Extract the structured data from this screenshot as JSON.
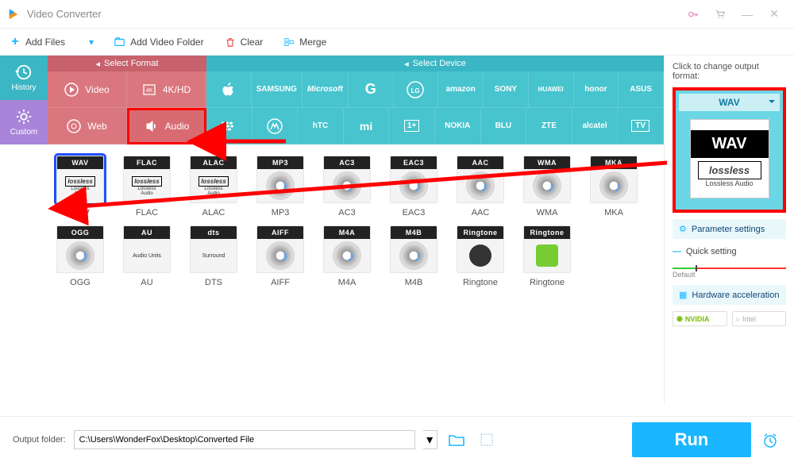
{
  "title": "Video Converter",
  "toolbar": {
    "add_files": "Add Files",
    "add_folder": "Add Video Folder",
    "clear": "Clear",
    "merge": "Merge"
  },
  "rail": {
    "history": "History",
    "custom": "Custom"
  },
  "cat_headers": {
    "format": "Select Format",
    "device": "Select Device"
  },
  "format_cats": {
    "video": "Video",
    "4k": "4K/HD",
    "web": "Web",
    "audio": "Audio"
  },
  "device_brands_row1": [
    "",
    "SAMSUNG",
    "Microsoft",
    "G",
    "LG",
    "amazon",
    "SONY",
    "HUAWEI",
    "honor",
    "ASUS"
  ],
  "device_brands_row2": [
    "",
    "",
    "hTC",
    "mi",
    "1+",
    "NOKIA",
    "BLU",
    "ZTE",
    "alcatel",
    "TV"
  ],
  "formats_row1": [
    {
      "head": "WAV",
      "body": "Lossless Audio",
      "label": "WAV",
      "selected": true,
      "lossless": true
    },
    {
      "head": "FLAC",
      "body": "Lossless Audio",
      "label": "FLAC",
      "lossless": true
    },
    {
      "head": "ALAC",
      "body": "Lossless Audio",
      "label": "ALAC",
      "lossless": true
    },
    {
      "head": "MP3",
      "body": "",
      "label": "MP3",
      "disc": true
    },
    {
      "head": "AC3",
      "body": "",
      "label": "AC3",
      "disc": true
    },
    {
      "head": "EAC3",
      "body": "",
      "label": "EAC3",
      "disc": true
    },
    {
      "head": "AAC",
      "body": "",
      "label": "AAC",
      "disc": true
    },
    {
      "head": "WMA",
      "body": "",
      "label": "WMA",
      "disc": true
    },
    {
      "head": "MKA",
      "body": "",
      "label": "MKA",
      "disc": true
    },
    {
      "head": "OGG",
      "body": "",
      "label": "OGG",
      "disc": true
    }
  ],
  "formats_row2": [
    {
      "head": "AU",
      "body": "Audio Units",
      "label": "AU"
    },
    {
      "head": "dts",
      "body": "Surround",
      "label": "DTS"
    },
    {
      "head": "AIFF",
      "body": "",
      "label": "AIFF",
      "disc": true
    },
    {
      "head": "M4A",
      "body": "",
      "label": "M4A",
      "disc": true
    },
    {
      "head": "M4B",
      "body": "",
      "label": "M4B",
      "disc": true
    },
    {
      "head": "Ringtone",
      "body": "",
      "label": "Ringtone",
      "apple": true
    },
    {
      "head": "Ringtone",
      "body": "",
      "label": "Ringtone",
      "android": true
    }
  ],
  "right": {
    "hint": "Click to change output format:",
    "selected": "WAV",
    "thumb_big": "WAV",
    "thumb_mid": "lossless",
    "thumb_sm": "Lossless Audio",
    "param": "Parameter settings",
    "quick": "Quick setting",
    "slider_label": "Default",
    "hw": "Hardware acceleration",
    "nvidia": "NVIDIA",
    "intel": "Intel"
  },
  "bottom": {
    "label": "Output folder:",
    "path": "C:\\Users\\WonderFox\\Desktop\\Converted File",
    "run": "Run"
  }
}
